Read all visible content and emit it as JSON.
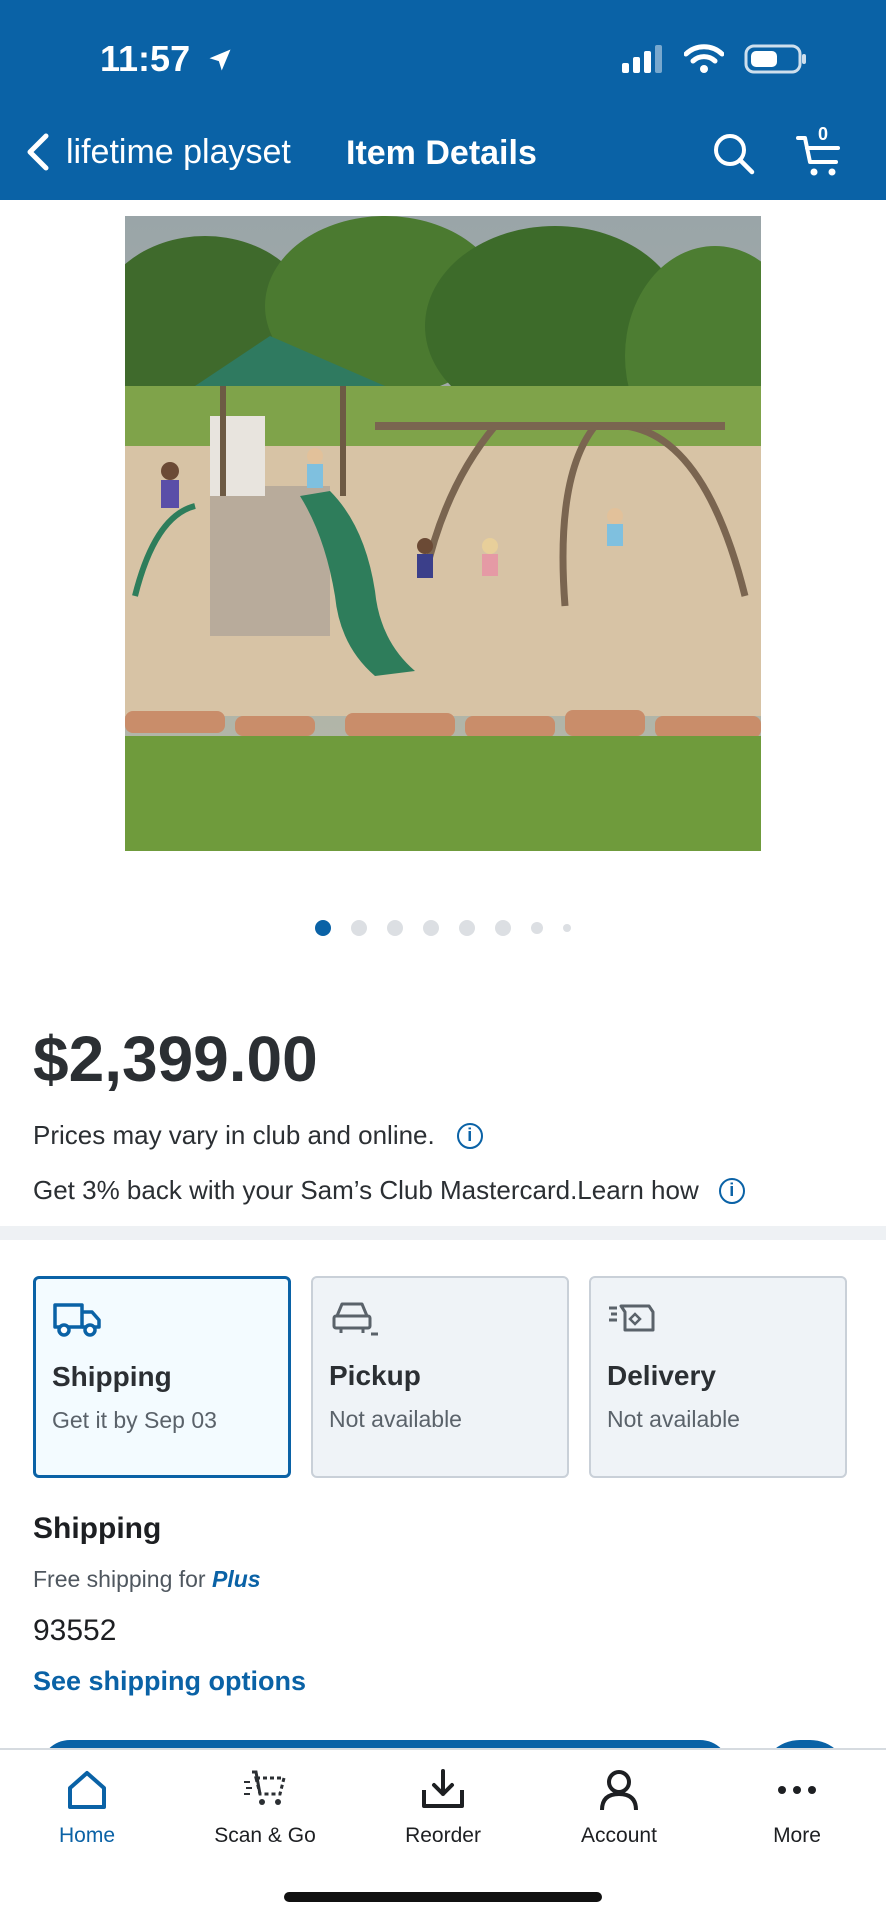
{
  "status": {
    "time": "11:57"
  },
  "nav": {
    "back_label": "lifetime playset",
    "title": "Item Details",
    "cart_count": "0"
  },
  "carousel": {
    "total": 8,
    "active_index": 0
  },
  "product": {
    "price": "$2,399.00",
    "price_note": "Prices may vary in club and online.",
    "cashback_text": "Get 3% back with your Sam’s Club Mastercard.",
    "learn_how": "Learn how"
  },
  "fulfillment": [
    {
      "title": "Shipping",
      "subtitle": "Get it by Sep 03",
      "icon": "truck-icon",
      "selected": true
    },
    {
      "title": "Pickup",
      "subtitle": "Not available",
      "icon": "car-icon",
      "selected": false
    },
    {
      "title": "Delivery",
      "subtitle": "Not available",
      "icon": "delivery-box-icon",
      "selected": false
    }
  ],
  "shipping": {
    "heading": "Shipping",
    "free_prefix": "Free shipping for ",
    "free_plus": "Plus",
    "zip": "93552",
    "see_options": "See shipping options"
  },
  "tabs": [
    {
      "label": "Home",
      "icon": "home-icon"
    },
    {
      "label": "Scan & Go",
      "icon": "scan-cart-icon"
    },
    {
      "label": "Reorder",
      "icon": "reorder-icon"
    },
    {
      "label": "Account",
      "icon": "account-icon"
    },
    {
      "label": "More",
      "icon": "more-icon"
    }
  ],
  "colors": {
    "brand": "#0a62a6",
    "divider": "#eef1f4"
  }
}
